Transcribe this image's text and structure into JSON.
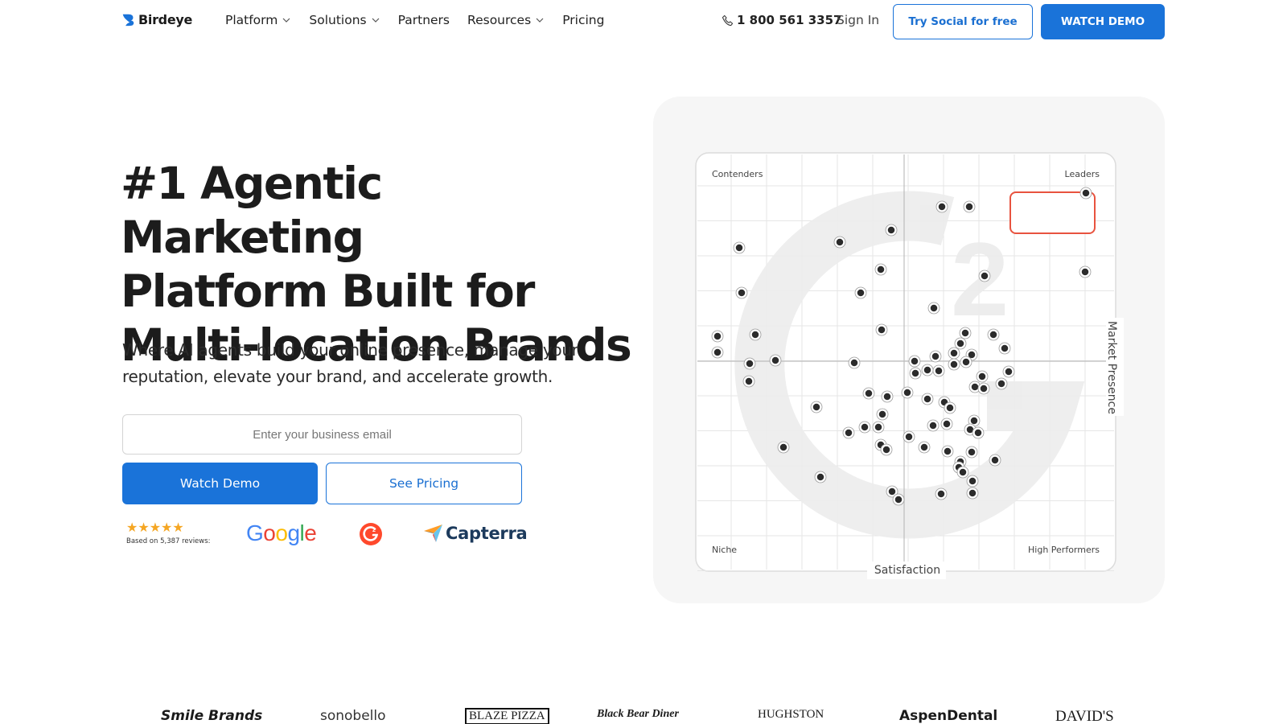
{
  "nav": {
    "brand": "Birdeye",
    "menu": [
      {
        "label": "Platform",
        "dropdown": true
      },
      {
        "label": "Solutions",
        "dropdown": true
      },
      {
        "label": "Partners",
        "dropdown": false
      },
      {
        "label": "Resources",
        "dropdown": true
      },
      {
        "label": "Pricing",
        "dropdown": false
      }
    ],
    "phone": "1 800 561 3357",
    "sign_in": "Sign In",
    "try_social": "Try Social for free",
    "watch_demo": "WATCH DEMO"
  },
  "hero": {
    "title_lines": [
      "#1 Agentic Marketing",
      "Platform Built for",
      "Multi-location Brands"
    ],
    "subtitle": "Where AI agents build your online presence, manage your reputation, elevate your brand, and accelerate growth.",
    "email_placeholder": "Enter your business email",
    "watch_demo_label": "Watch Demo",
    "see_pricing_label": "See Pricing"
  },
  "ratings": {
    "stars": "★★★★★",
    "reviews_text": "Based on 5,387 reviews:",
    "google": [
      "G",
      "o",
      "o",
      "g",
      "l",
      "e"
    ],
    "capterra": "Capterra"
  },
  "grid": {
    "quadrants": {
      "top_left": "Contenders",
      "top_right": "Leaders",
      "bottom_left": "Niche",
      "bottom_right": "High Performers"
    },
    "x_axis": "Satisfaction",
    "y_axis": "Market Presence"
  },
  "logos": [
    "Smile Brands",
    "sonobello",
    "BLAZE PIZZA",
    "Black Bear Diner",
    "HUGHSTON",
    "AspenDental",
    "DAVID'S"
  ],
  "colors": {
    "accent": "#1a73d9",
    "highlight": "#e8533f",
    "star": "#f5a623"
  }
}
